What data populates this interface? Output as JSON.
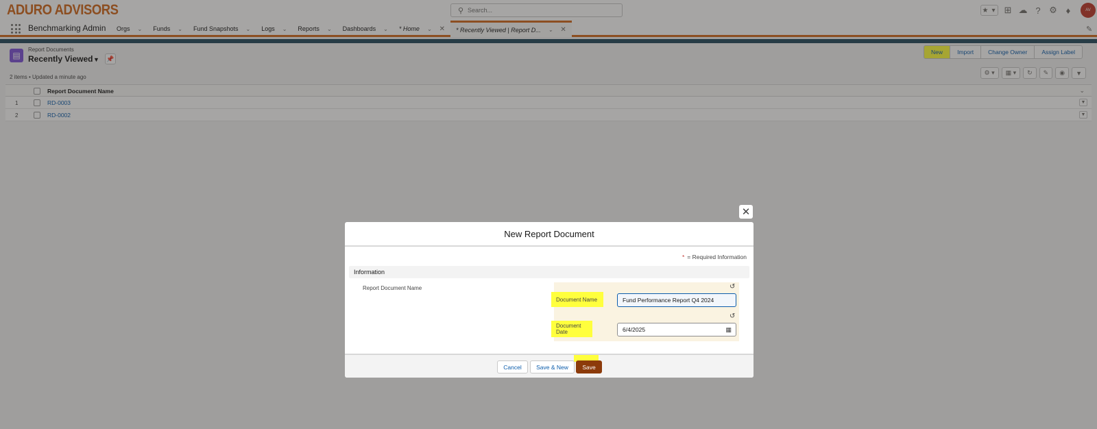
{
  "header": {
    "logo": "ADURO ADVISORS",
    "search_placeholder": "Search...",
    "avatar_text": "AV"
  },
  "nav": {
    "app_name": "Benchmarking Admin",
    "items": [
      {
        "label": "Orgs"
      },
      {
        "label": "Funds"
      },
      {
        "label": "Fund Snapshots"
      },
      {
        "label": "Logs"
      },
      {
        "label": "Reports"
      },
      {
        "label": "Dashboards"
      },
      {
        "label": "* Home"
      },
      {
        "label": "* Recently Viewed | Report D..."
      }
    ]
  },
  "list": {
    "object_label": "Report Documents",
    "view_name": "Recently Viewed",
    "meta": "2 items • Updated a minute ago",
    "buttons": [
      "New",
      "Import",
      "Change Owner",
      "Assign Label"
    ],
    "column_header": "Report Document Name",
    "rows": [
      {
        "num": "1",
        "name": "RD-0003"
      },
      {
        "num": "2",
        "name": "RD-0002"
      }
    ]
  },
  "modal": {
    "title": "New Report Document",
    "required_note": "= Required Information",
    "section": "Information",
    "name_label": "Report Document Name",
    "doc_name_label": "Document Name",
    "doc_name_value": "Fund Performance Report Q4 2024",
    "doc_date_label": "Document Date",
    "doc_date_value": "6/4/2025",
    "cancel": "Cancel",
    "save_new": "Save & New",
    "save": "Save"
  },
  "colors": {
    "brand": "#d2691e",
    "link": "#0b5cab",
    "highlight": "#ffff3d",
    "save_button": "#8c3b0b"
  }
}
